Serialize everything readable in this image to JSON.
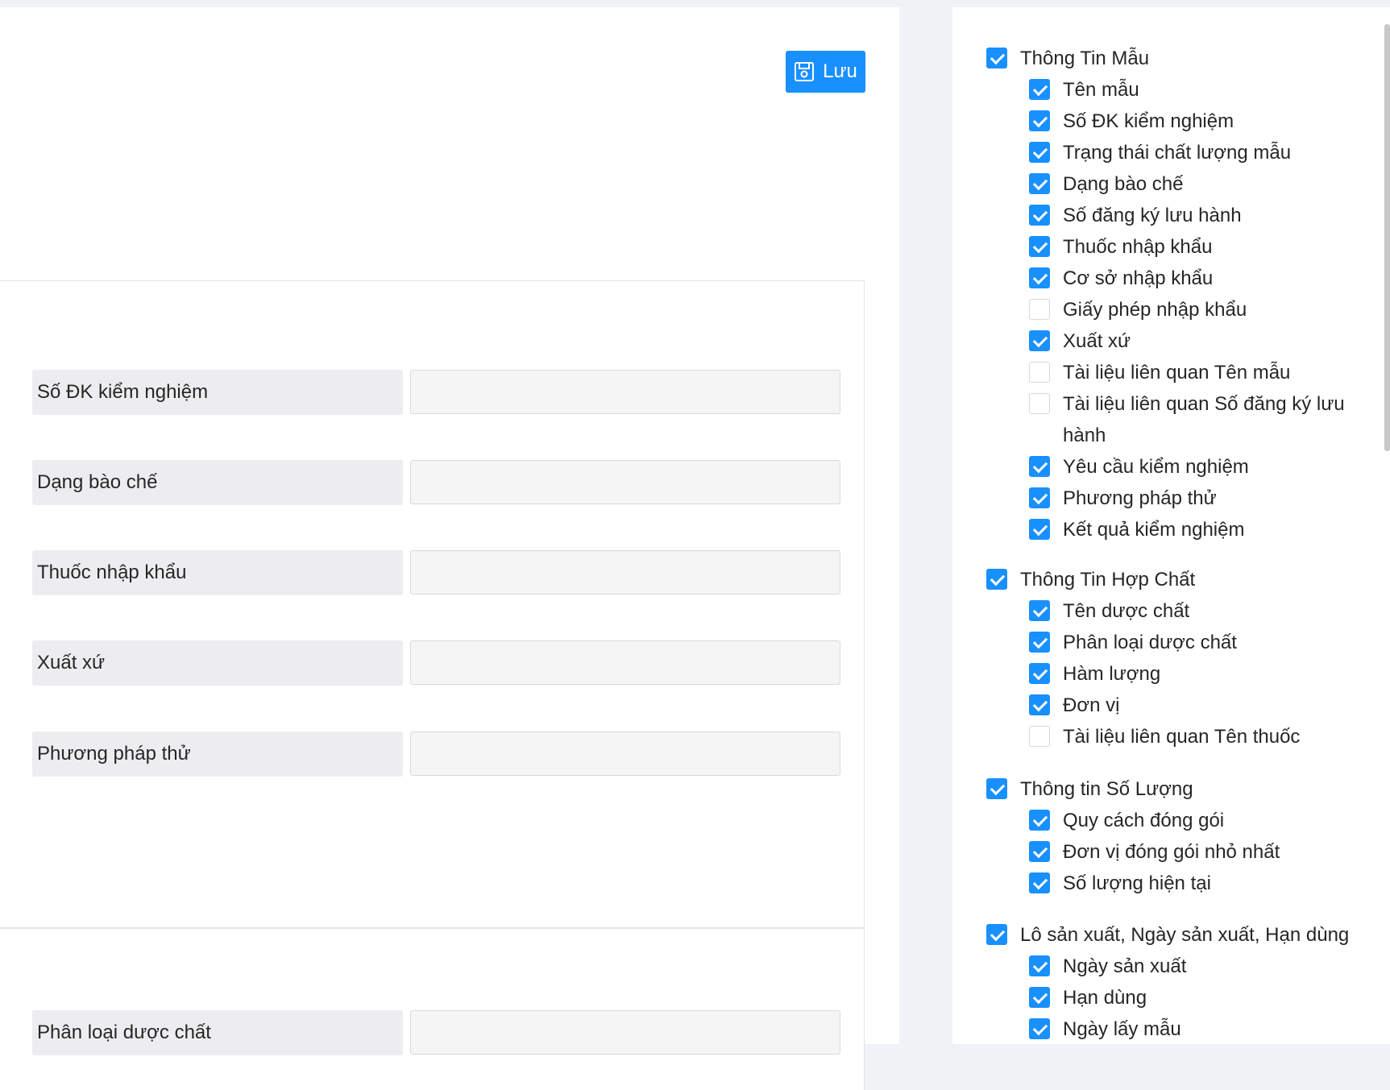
{
  "toolbar": {
    "save_label": "Lưu"
  },
  "form_fields": [
    {
      "label": "Số ĐK kiểm nghiệm",
      "value": ""
    },
    {
      "label": "Dạng bào chế",
      "value": ""
    },
    {
      "label": "Thuốc nhập khẩu",
      "value": ""
    },
    {
      "label": "Xuất xứ",
      "value": ""
    },
    {
      "label": "Phương pháp thử",
      "value": ""
    }
  ],
  "form_fields_2": [
    {
      "label": "Phân loại dược chất",
      "value": ""
    }
  ],
  "column_groups": [
    {
      "label": "Thông Tin Mẫu",
      "checked": true,
      "items": [
        {
          "label": "Tên mẫu",
          "checked": true
        },
        {
          "label": "Số ĐK kiểm nghiệm",
          "checked": true
        },
        {
          "label": "Trạng thái chất lượng mẫu",
          "checked": true
        },
        {
          "label": "Dạng bào chế",
          "checked": true
        },
        {
          "label": "Số đăng ký lưu hành",
          "checked": true
        },
        {
          "label": "Thuốc nhập khẩu",
          "checked": true
        },
        {
          "label": "Cơ sở nhập khẩu",
          "checked": true
        },
        {
          "label": "Giấy phép nhập khẩu",
          "checked": false
        },
        {
          "label": "Xuất xứ",
          "checked": true
        },
        {
          "label": "Tài liệu liên quan Tên mẫu",
          "checked": false
        },
        {
          "label": "Tài liệu liên quan Số đăng ký lưu hành",
          "checked": false
        },
        {
          "label": "Yêu cầu kiểm nghiệm",
          "checked": true
        },
        {
          "label": "Phương pháp thử",
          "checked": true
        },
        {
          "label": "Kết quả kiểm nghiệm",
          "checked": true
        }
      ]
    },
    {
      "label": "Thông Tin Hợp Chất",
      "checked": true,
      "items": [
        {
          "label": "Tên dược chất",
          "checked": true
        },
        {
          "label": "Phân loại dược chất",
          "checked": true
        },
        {
          "label": "Hàm lượng",
          "checked": true
        },
        {
          "label": "Đơn vị",
          "checked": true
        },
        {
          "label": "Tài liệu liên quan Tên thuốc",
          "checked": false
        }
      ]
    },
    {
      "label": "Thông tin Số Lượng",
      "checked": true,
      "items": [
        {
          "label": "Quy cách đóng gói",
          "checked": true
        },
        {
          "label": "Đơn vị đóng gói nhỏ nhất",
          "checked": true
        },
        {
          "label": "Số lượng hiện tại",
          "checked": true
        }
      ]
    },
    {
      "label": "Lô sản xuất, Ngày sản xuất, Hạn dùng",
      "checked": true,
      "items": [
        {
          "label": "Ngày sản xuất",
          "checked": true
        },
        {
          "label": "Hạn dùng",
          "checked": true
        },
        {
          "label": "Ngày lấy mẫu",
          "checked": true
        }
      ]
    }
  ],
  "colors": {
    "primary": "#1890ff",
    "label_bg": "#ededf0",
    "input_bg": "#f5f5f5",
    "page_bg": "#f0f2f5"
  }
}
